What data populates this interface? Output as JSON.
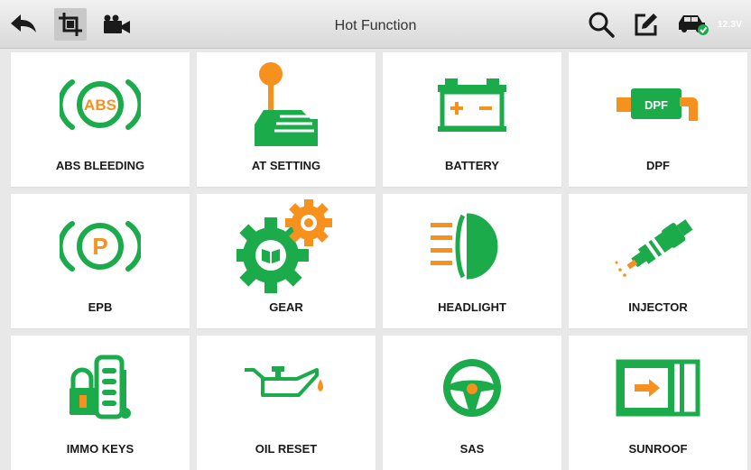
{
  "header": {
    "title": "Hot Function",
    "voltage": "12.3V"
  },
  "colors": {
    "green": "#1bab4b",
    "orange": "#f7911e",
    "topbar": "#e3e3e3"
  },
  "toolbar_icons": [
    "back-arrow-icon",
    "screenshot-crop-icon",
    "video-camera-icon",
    "search-icon",
    "edit-icon",
    "vehicle-connected-icon"
  ],
  "functions": [
    {
      "label": "ABS BLEEDING",
      "icon": "abs-icon"
    },
    {
      "label": "AT SETTING",
      "icon": "gear-shifter-icon"
    },
    {
      "label": "BATTERY",
      "icon": "battery-icon"
    },
    {
      "label": "DPF",
      "icon": "dpf-icon"
    },
    {
      "label": "EPB",
      "icon": "parking-brake-icon"
    },
    {
      "label": "GEAR",
      "icon": "gear-cogs-icon"
    },
    {
      "label": "HEADLIGHT",
      "icon": "headlight-icon"
    },
    {
      "label": "INJECTOR",
      "icon": "injector-icon"
    },
    {
      "label": "IMMO KEYS",
      "icon": "immo-key-icon"
    },
    {
      "label": "OIL RESET",
      "icon": "oil-can-icon"
    },
    {
      "label": "SAS",
      "icon": "steering-wheel-icon"
    },
    {
      "label": "SUNROOF",
      "icon": "sunroof-icon"
    }
  ]
}
